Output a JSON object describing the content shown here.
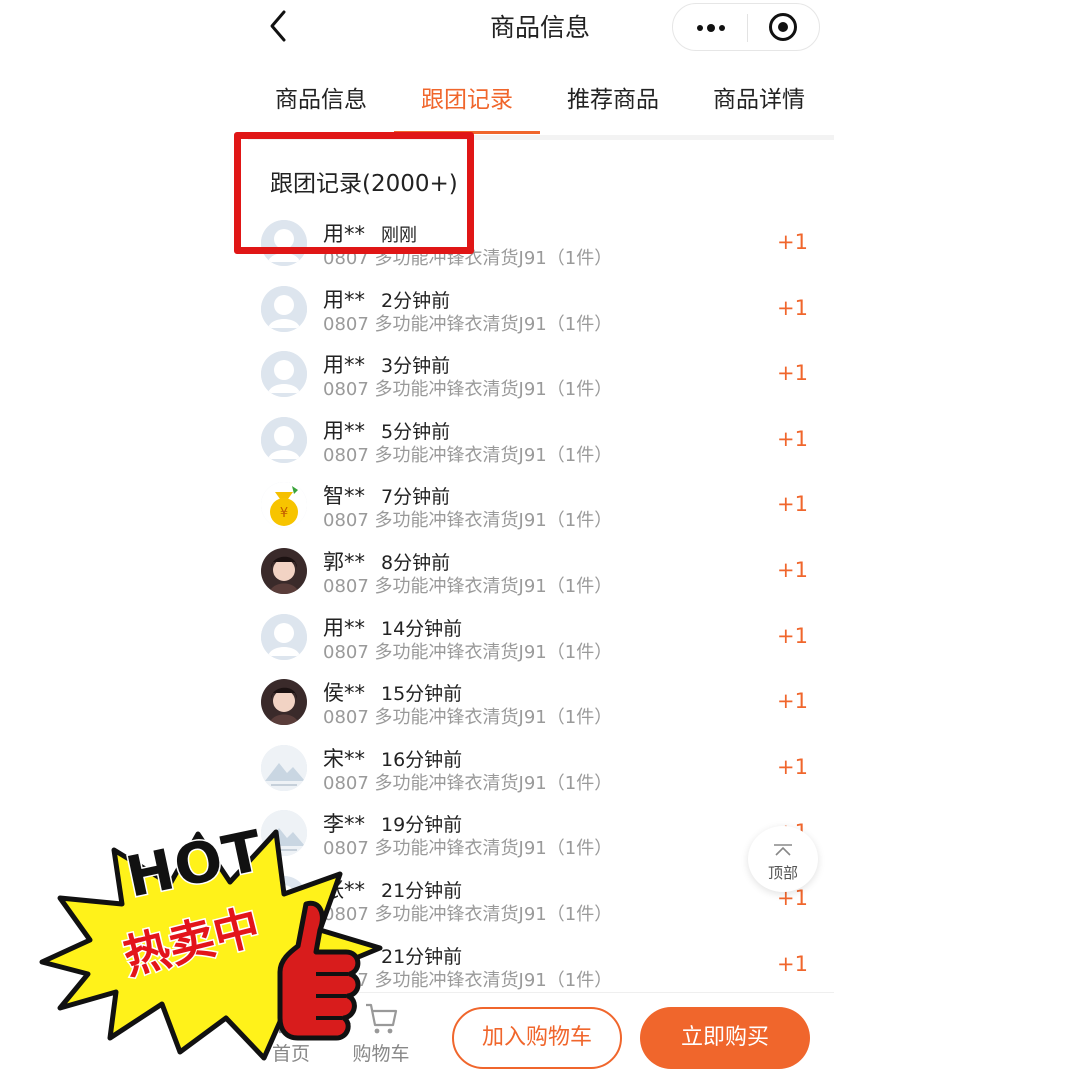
{
  "header": {
    "title": "商品信息"
  },
  "tabs": [
    {
      "label": "商品信息",
      "active": false
    },
    {
      "label": "跟团记录",
      "active": true
    },
    {
      "label": "推荐商品",
      "active": false
    },
    {
      "label": "商品详情",
      "active": false
    }
  ],
  "section": {
    "title": "跟团记录",
    "count": "(2000+)"
  },
  "records": [
    {
      "name": "用**",
      "time": "刚刚",
      "product": "0807 多功能冲锋衣清货J91（1件）",
      "qty": "+1",
      "avatar": "default-avatar"
    },
    {
      "name": "用**",
      "time": "2分钟前",
      "product": "0807 多功能冲锋衣清货J91（1件）",
      "qty": "+1",
      "avatar": "default-avatar"
    },
    {
      "name": "用**",
      "time": "3分钟前",
      "product": "0807 多功能冲锋衣清货J91（1件）",
      "qty": "+1",
      "avatar": "default-avatar"
    },
    {
      "name": "用**",
      "time": "5分钟前",
      "product": "0807 多功能冲锋衣清货J91（1件）",
      "qty": "+1",
      "avatar": "default-avatar"
    },
    {
      "name": "智**",
      "time": "7分钟前",
      "product": "0807 多功能冲锋衣清货J91（1件）",
      "qty": "+1",
      "avatar": "money-bag-avatar"
    },
    {
      "name": "郭**",
      "time": "8分钟前",
      "product": "0807 多功能冲锋衣清货J91（1件）",
      "qty": "+1",
      "avatar": "photo-avatar"
    },
    {
      "name": "用**",
      "time": "14分钟前",
      "product": "0807 多功能冲锋衣清货J91（1件）",
      "qty": "+1",
      "avatar": "default-avatar"
    },
    {
      "name": "侯**",
      "time": "15分钟前",
      "product": "0807 多功能冲锋衣清货J91（1件）",
      "qty": "+1",
      "avatar": "photo-avatar"
    },
    {
      "name": "宋**",
      "time": "16分钟前",
      "product": "0807 多功能冲锋衣清货J91（1件）",
      "qty": "+1",
      "avatar": "landscape-avatar"
    },
    {
      "name": "李**",
      "time": "19分钟前",
      "product": "0807 多功能冲锋衣清货J91（1件）",
      "qty": "+1",
      "avatar": "landscape-avatar"
    },
    {
      "name": "张**",
      "time": "21分钟前",
      "product": "0807 多功能冲锋衣清货J91（1件）",
      "qty": "+1",
      "avatar": "default-avatar"
    },
    {
      "name": "",
      "time": "21分钟前",
      "product": "0807 多功能冲锋衣清货J91（1件）",
      "qty": "+1",
      "avatar": "default-avatar"
    }
  ],
  "to_top": {
    "label": "顶部"
  },
  "bottom": {
    "home_label": "首页",
    "cart_label": "购物车",
    "add_cart": "加入购物车",
    "buy_now": "立即购买"
  },
  "sticker": {
    "hot": "HOT",
    "sale": "热卖中"
  },
  "colors": {
    "accent": "#f0662c",
    "highlight": "#e01616",
    "muted": "#9a9a9a"
  }
}
